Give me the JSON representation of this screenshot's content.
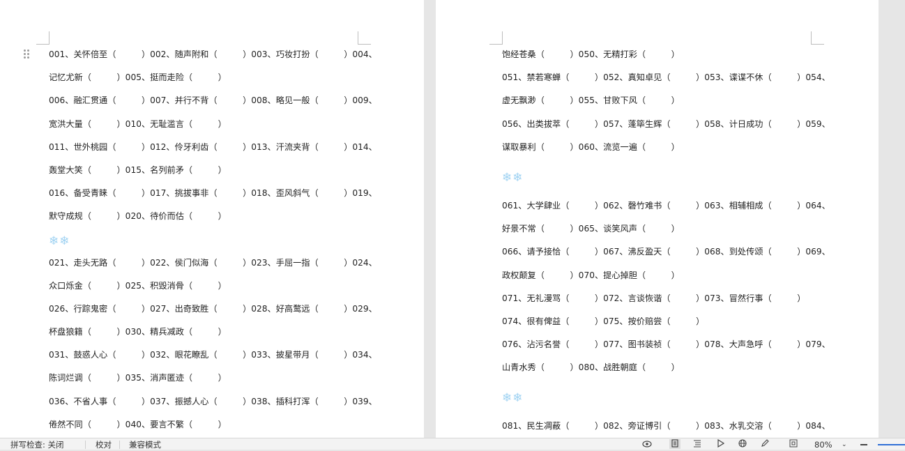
{
  "left_page": {
    "lines": [
      "001、关怀倍至（　　　）002、随声附和（　　　）003、巧妆打扮（　　　）004、",
      "记忆尤新（　　　）005、挺而走险（　　　）",
      "006、融汇贯通（　　　）007、并行不背（　　　）008、略见一般（　　　）009、",
      "宽洪大量（　　　）010、无耻滥言（　　　）",
      "011、世外桃园（　　　）012、伶牙利齿（　　　）013、汗流夹背（　　　）014、",
      "轰堂大笑（　　　）015、名列前矛（　　　）",
      "016、备受青睐（　　　）017、挑拔事非（　　　）018、歪风斜气（　　　）019、",
      "默守成规（　　　）020、待价而估（　　　）",
      "❄❄",
      "021、走头无路（　　　）022、侯门似海（　　　）023、手屈一指（　　　）024、",
      "众口烁金（　　　）025、积毁消骨（　　　）",
      "026、行踪鬼密（　　　）027、出奇致胜（　　　）028、好高鹜远（　　　）029、",
      "杯盘狼籍（　　　）030、精兵减政（　　　）",
      "031、鼓惑人心（　　　）032、眼花瞭乱（　　　）033、披星带月（　　　）034、",
      "陈词烂调（　　　）035、消声匿迹（　　　）",
      "036、不省人事（　　　）037、振撼人心（　　　）038、插科打浑（　　　）039、",
      "倦然不同（　　　）040、要言不繁（　　　）"
    ]
  },
  "right_page": {
    "lines": [
      "饱经苍桑（　　　）050、无精打彩（　　　）",
      "051、禁若寒蝉（　　　）052、真知卓见（　　　）053、谍谍不休（　　　）054、",
      "虚无飘渺（　　　）055、甘败下风（　　　）",
      "056、出类拔萃（　　　）057、蓬筚生辉（　　　）058、计日成功（　　　）059、",
      "谋取暴利（　　　）060、流览一遍（　　　）",
      "❄❄",
      "061、大学肆业（　　　）062、磬竹难书（　　　）063、相辅相成（　　　）064、",
      "好景不常（　　　）065、谈笑风声（　　　）",
      "066、请予接恰（　　　）067、沸反盈天（　　　）068、到处传颂（　　　）069、",
      "政权颠复（　　　）070、提心掉胆（　　　）",
      "071、无礼漫骂（　　　）072、言谈恢谐（　　　）073、冒然行事（　　　）",
      "074、很有俾益（　　　）075、按价赔尝（　　　）",
      "076、沾污名誉（　　　）077、图书装祯（　　　）078、大声急呼（　　　）079、",
      "山青水秀（　　　）080、战胜朝庭（　　　）",
      "❄❄",
      "081、民生凋蔽（　　　）082、旁证博引（　　　）083、水乳交溶（　　　）084、"
    ]
  },
  "statusbar": {
    "spellcheck": "拼写检查: 关闭",
    "proofread": "校对",
    "compat_mode": "兼容模式",
    "zoom": "80%",
    "icons": [
      "eye-icon",
      "page-view-icon",
      "outline-view-icon",
      "play-icon",
      "web-view-icon",
      "pen-icon",
      "fit-page-icon",
      "zoom-out-icon",
      "zoom-in-icon"
    ]
  },
  "colors": {
    "snowflake": "#9fd2f2",
    "text": "#222222",
    "background": "#e6e6e6"
  }
}
